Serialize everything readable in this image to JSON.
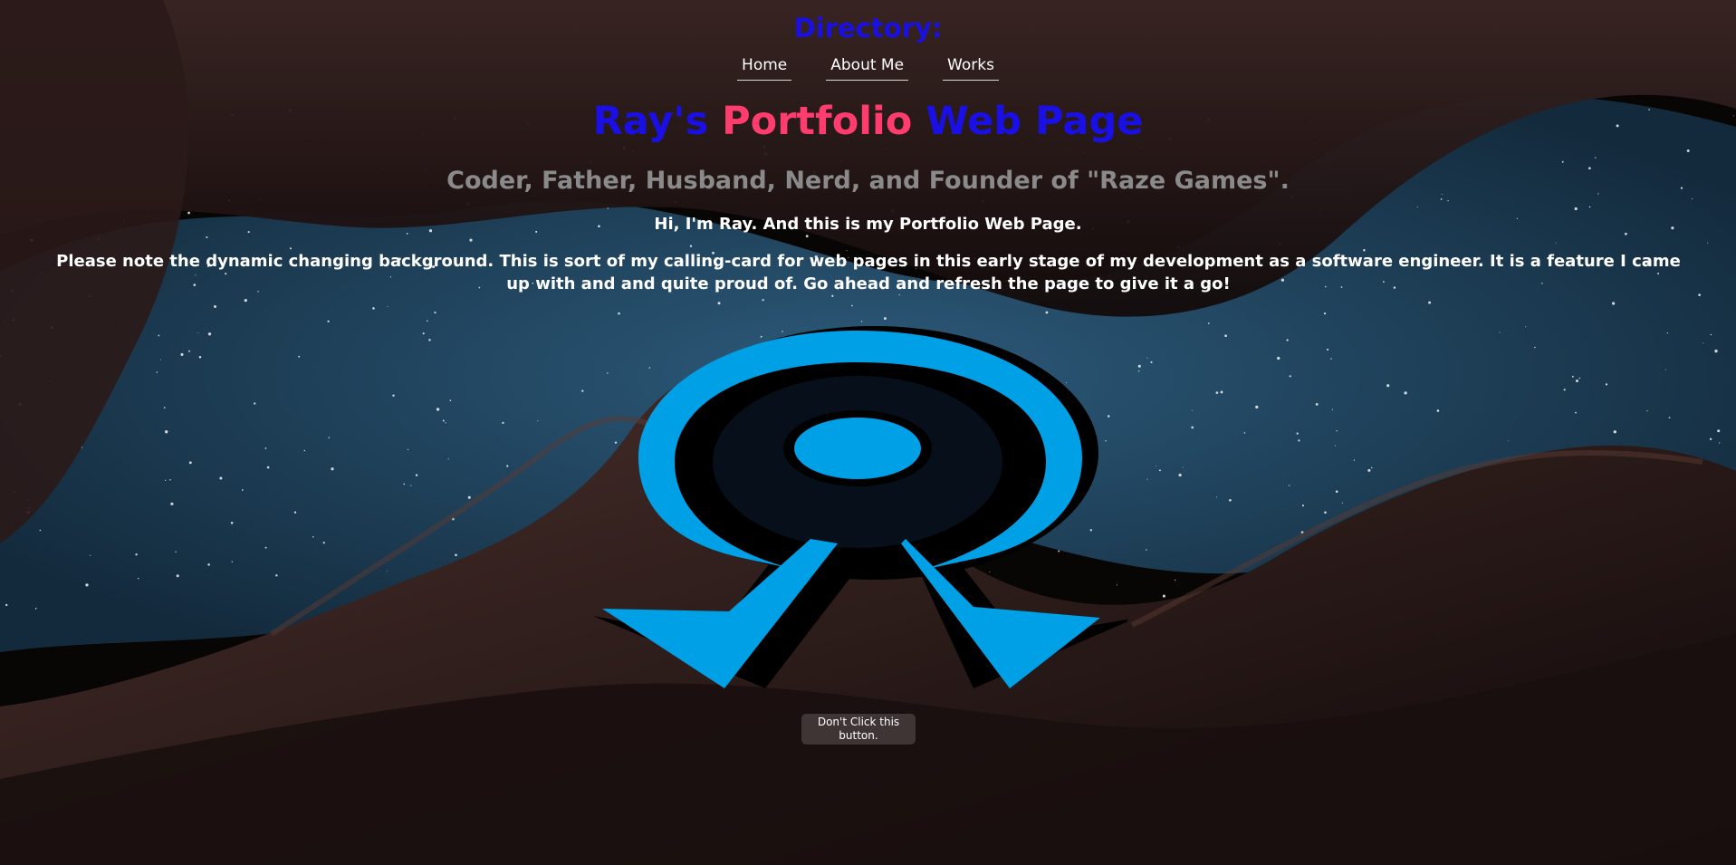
{
  "directory": {
    "title": "Directory:",
    "links": [
      "Home",
      "About Me",
      "Works"
    ]
  },
  "page_title": {
    "part1": "Ray's",
    "part2": "Portfolio",
    "part3": "Web Page"
  },
  "tagline": "Coder, Father, Husband, Nerd, and Founder of \"Raze Games\".",
  "intro": "Hi, I'm Ray. And this is my Portfolio Web Page.",
  "note": "Please note the dynamic changing background. This is sort of my calling-card for web pages in this early stage of my development as a software engineer. It is a feature I came up with and and quite proud of. Go ahead and refresh the page to give it a go!",
  "button_label": "Don't Click this button.",
  "colors": {
    "directory_blue": "#1a10e6",
    "title_pink": "#ff3c6e",
    "tagline_gray": "#8a8a8a",
    "logo_blue": "#00a0e6"
  }
}
